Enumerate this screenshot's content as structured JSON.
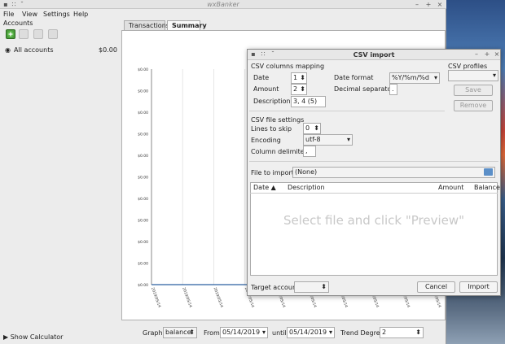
{
  "window": {
    "title": "wxBanker"
  },
  "menu": {
    "items": [
      "File",
      "View",
      "Settings",
      "Help"
    ]
  },
  "sidebar": {
    "accounts_label": "Accounts",
    "tools": [
      "add-icon",
      "remove-icon",
      "edit-icon",
      "cancel-icon"
    ],
    "account": {
      "name": "All accounts",
      "balance": "$0.00"
    },
    "calculator_label": "Show Calculator"
  },
  "tabs": [
    {
      "label": "Transactions"
    },
    {
      "label": "Summary"
    }
  ],
  "chart_data": {
    "type": "line",
    "title": "",
    "xlabel": "",
    "ylabel": "",
    "y_tick_labels": [
      "$0.00",
      "$0.00",
      "$0.00",
      "$0.00",
      "$0.00",
      "$0.00",
      "$0.00",
      "$0.00",
      "$0.00",
      "$0.00",
      "$0.00"
    ],
    "x_tick_labels": [
      "2019/05/14",
      "2019/05/14",
      "2019/05/14",
      "2019/05/14",
      "2019/05/14",
      "2019/05/14",
      "2019/05/14",
      "2019/05/14",
      "2019/05/14",
      "2019/05/14"
    ],
    "series": [
      {
        "values": [
          0,
          0,
          0,
          0,
          0,
          0,
          0,
          0,
          0,
          0
        ]
      }
    ],
    "grid": true,
    "line_color": "#2b5fa0"
  },
  "graph_controls": {
    "graph_label": "Graph",
    "graph_value": "balance",
    "from_label": "From",
    "from_value": "05/14/2019",
    "until_label": "until",
    "until_value": "05/14/2019",
    "trend_label": "Trend Degree",
    "trend_value": "2"
  },
  "csv_dialog": {
    "title": "CSV import",
    "mapping": {
      "group_title": "CSV columns mapping",
      "date_label": "Date",
      "date_value": "1",
      "amount_label": "Amount",
      "amount_value": "2",
      "description_label": "Description",
      "description_value": "3, 4 (5)",
      "date_format_label": "Date format",
      "date_format_value": "%Y/%m/%d",
      "decimal_sep_label": "Decimal separator",
      "decimal_sep_value": "."
    },
    "profiles": {
      "group_title": "CSV profiles",
      "save_label": "Save",
      "remove_label": "Remove"
    },
    "file_settings": {
      "group_title": "CSV file settings",
      "lines_skip_label": "Lines to skip",
      "lines_skip_value": "0",
      "encoding_label": "Encoding",
      "encoding_value": "utf-8",
      "delimiter_label": "Column delimiter",
      "delimiter_value": ","
    },
    "file": {
      "label": "File to import",
      "value": "(None)"
    },
    "preview": {
      "columns": [
        "Date",
        "Description",
        "Amount",
        "Balance"
      ],
      "placeholder": "Select file and click \"Preview\""
    },
    "target_label": "Target account",
    "cancel_label": "Cancel",
    "import_label": "Import"
  }
}
